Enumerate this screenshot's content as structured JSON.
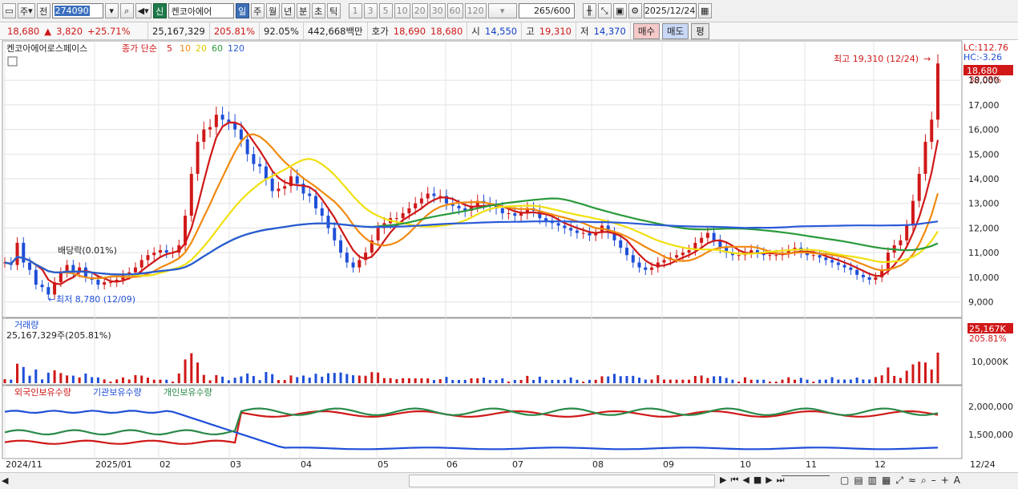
{
  "toolbar": {
    "period_label": "주",
    "prev_label": "전",
    "stock_code": "274090",
    "badge": "신",
    "stock_name": "켄코아에어",
    "interval_tabs": [
      "일",
      "주",
      "월",
      "년",
      "분",
      "초",
      "틱"
    ],
    "interval_selected": "일",
    "minute_tabs": [
      "1",
      "3",
      "5",
      "10",
      "20",
      "30",
      "60",
      "120"
    ],
    "count": "265/600",
    "date": "2025/12/24"
  },
  "info": {
    "price": "18,680",
    "change": "3,820",
    "change_pct": "+25.71%",
    "volume": "25,167,329",
    "vol_ratio": "205.81%",
    "ratio2": "92.05%",
    "amount": "442,668백만",
    "ask_label": "호가",
    "ask": "18,690",
    "bid": "18,680",
    "open_label": "시",
    "open": "14,550",
    "high_label": "고",
    "high": "19,310",
    "low_label": "저",
    "low": "14,370",
    "buy_label": "매수",
    "sell_label": "매도",
    "flat_label": "평"
  },
  "price_panel": {
    "name": "켄코아에어로스페이스",
    "legend_label": "종가 단순",
    "ma_periods": [
      "5",
      "10",
      "20",
      "60",
      "120"
    ],
    "ma_colors": [
      "#d01818",
      "#f08a10",
      "#f0e010",
      "#2a9a3a",
      "#2a5ad8"
    ],
    "lc": "LC:112.76",
    "hc": "HC:-3.26",
    "last_price": "18,680",
    "last_pct": "30.08%",
    "high_annot": "최고 19,310 (12/24)",
    "low_annot": "최저 8,780 (12/09)",
    "div_annot": "배당락(0.01%)",
    "y_ticks": [
      "18,000",
      "17,000",
      "16,000",
      "15,000",
      "14,000",
      "13,000",
      "12,000",
      "11,000",
      "10,000",
      "9,000"
    ]
  },
  "volume_panel": {
    "title": "거래량",
    "detail": "25,167,329주(205.81%)",
    "last": "25,167K",
    "last_pct": "205.81%",
    "tick": "10,000K"
  },
  "holding_panel": {
    "legend": [
      "외국인보유수량",
      "기관보유수량",
      "개인보유수량"
    ],
    "colors": [
      "#d01818",
      "#1f4fd8",
      "#2a8a4a"
    ],
    "ticks": [
      "2,000,000",
      "1,500,000"
    ]
  },
  "x_axis": [
    "2024/11",
    "2025/01",
    "02",
    "03",
    "04",
    "05",
    "06",
    "07",
    "08",
    "09",
    "10",
    "11",
    "12"
  ],
  "x_last": "12/24",
  "chart_data": {
    "type": "line",
    "title": "켄코아에어로스페이스",
    "daily_close_approx": [
      10600,
      10500,
      11400,
      10600,
      10300,
      9700,
      9600,
      9300,
      9800,
      10200,
      10500,
      10200,
      10400,
      10000,
      9900,
      9700,
      9800,
      9800,
      9900,
      10100,
      10200,
      10400,
      10700,
      10900,
      11000,
      11100,
      11000,
      11000,
      11300,
      12500,
      14200,
      15500,
      16000,
      16100,
      16600,
      16400,
      16300,
      16000,
      15600,
      15000,
      14600,
      14500,
      14000,
      13500,
      13600,
      13700,
      14100,
      13800,
      13400,
      13300,
      12800,
      12500,
      12000,
      11500,
      11000,
      10600,
      10400,
      10700,
      11000,
      11500,
      12000,
      12200,
      12400,
      12400,
      12600,
      12800,
      13000,
      13200,
      13400,
      13300,
      13300,
      13000,
      12900,
      12800,
      12700,
      12900,
      13100,
      13000,
      12900,
      12800,
      12600,
      12600,
      12500,
      12600,
      12800,
      12700,
      12400,
      12300,
      12200,
      12100,
      12000,
      11900,
      11800,
      11800,
      11700,
      11800,
      12100,
      11800,
      11500,
      11200,
      10900,
      10600,
      10400,
      10300,
      10400,
      10600,
      10700,
      10800,
      10900,
      11000,
      11100,
      11400,
      11600,
      11800,
      11500,
      11200,
      11000,
      10900,
      10900,
      11000,
      11100,
      11000,
      10900,
      10900,
      10900,
      11000,
      11100,
      11200,
      11000,
      10900,
      10900,
      10800,
      10700,
      10600,
      10500,
      10400,
      10300,
      10100,
      10000,
      9900,
      10000,
      10300,
      11000,
      11300,
      11500,
      12100,
      13100,
      14200,
      15500,
      16400,
      18680
    ],
    "high": 19310,
    "low": 8780,
    "ylim": [
      8500,
      19500
    ],
    "volume_last": 25167329,
    "holding_ylim": [
      1200000,
      2400000
    ]
  }
}
